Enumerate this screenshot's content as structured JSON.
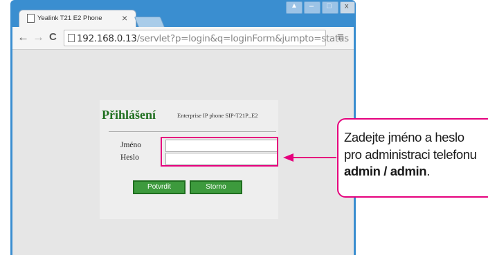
{
  "browser": {
    "tab_title": "Yealink T21 E2 Phone",
    "tab_close": "×",
    "back": "←",
    "forward": "→",
    "reload": "C",
    "url_host": "192.168.0.13",
    "url_path": "/servlet?p=login&q=loginForm&jumpto=status",
    "menu": "≡",
    "window_controls": [
      "▲",
      "–",
      "□",
      "x"
    ]
  },
  "login": {
    "title": "Přihlášení",
    "subtitle": "Enterprise IP phone SIP-T21P_E2",
    "username_label": "Jméno",
    "username_value": "",
    "password_label": "Heslo",
    "password_value": "",
    "confirm_button": "Potvrdit",
    "cancel_button": "Storno"
  },
  "callout": {
    "line1": "Zadejte jméno a heslo",
    "line2": "pro administraci telefonu",
    "credentials": "admin / admin",
    "period": "."
  },
  "colors": {
    "accent": "#e5007d",
    "window_frame": "#3a8ed0",
    "button_green": "#3d9a3d",
    "title_green": "#1f6f1f"
  }
}
